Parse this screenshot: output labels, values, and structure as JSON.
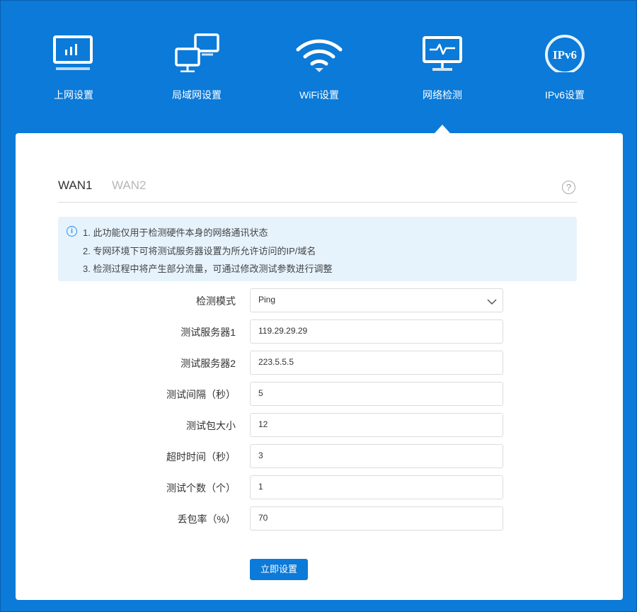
{
  "nav": {
    "items": [
      {
        "label": "上网设置",
        "icon": "monitor-chart-icon"
      },
      {
        "label": "局域网设置",
        "icon": "lan-computers-icon"
      },
      {
        "label": "WiFi设置",
        "icon": "wifi-icon"
      },
      {
        "label": "网络检测",
        "icon": "network-monitor-icon",
        "active": true
      },
      {
        "label": "IPv6设置",
        "icon": "ipv6-icon"
      }
    ],
    "ipv6_badge": "IPv6"
  },
  "tabs": {
    "wan1": "WAN1",
    "wan2": "WAN2",
    "help": "?"
  },
  "notice": {
    "icon": "i",
    "lines": [
      "1. 此功能仅用于检测硬件本身的网络通讯状态",
      "2. 专网环境下可将测试服务器设置为所允许访问的IP/域名",
      "3. 检测过程中将产生部分流量，可通过修改测试参数进行调整"
    ]
  },
  "form": {
    "mode": {
      "label": "检测模式",
      "value": "Ping"
    },
    "server1": {
      "label": "测试服务器1",
      "value": "119.29.29.29"
    },
    "server2": {
      "label": "测试服务器2",
      "value": "223.5.5.5"
    },
    "interval": {
      "label": "测试间隔（秒）",
      "value": "5"
    },
    "packet_size": {
      "label": "测试包大小",
      "value": "12"
    },
    "timeout": {
      "label": "超时时间（秒）",
      "value": "3"
    },
    "count": {
      "label": "测试个数（个）",
      "value": "1"
    },
    "loss_rate": {
      "label": "丢包率（%）",
      "value": "70"
    }
  },
  "submit_label": "立即设置",
  "colors": {
    "brand_blue": "#0b7ad8",
    "notice_bg": "#e6f3fd",
    "tab_inactive": "#b7b7b7"
  }
}
